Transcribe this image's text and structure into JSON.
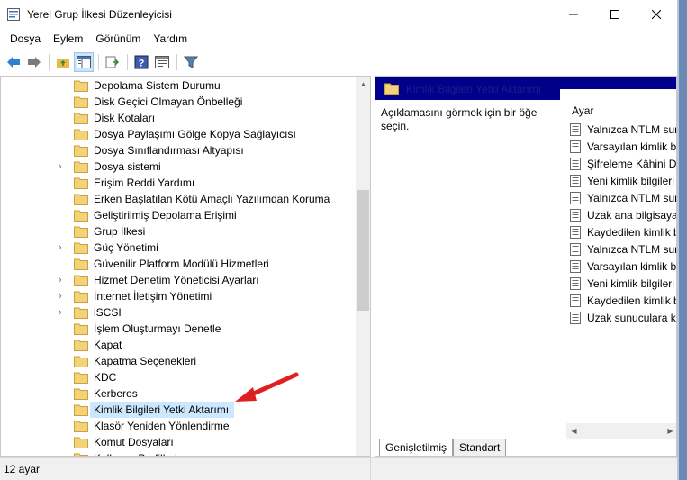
{
  "window": {
    "title": "Yerel Grup İlkesi Düzenleyicisi",
    "minimize": "—",
    "maximize": "☐",
    "close": "✕"
  },
  "menu": [
    "Dosya",
    "Eylem",
    "Görünüm",
    "Yardım"
  ],
  "toolbar": {
    "icons": [
      "back-arrow-icon",
      "forward-arrow-icon",
      "up-folder-icon",
      "show-tree-icon",
      "export-list-icon",
      "help-icon",
      "properties-icon",
      "filter-icon"
    ]
  },
  "tree": {
    "items": [
      {
        "label": "Depolama Sistem Durumu",
        "expandable": false
      },
      {
        "label": "Disk Geçici Olmayan Önbelleği",
        "expandable": false
      },
      {
        "label": "Disk Kotaları",
        "expandable": false
      },
      {
        "label": "Dosya Paylaşımı Gölge Kopya Sağlayıcısı",
        "expandable": false
      },
      {
        "label": "Dosya Sınıflandırması Altyapısı",
        "expandable": false
      },
      {
        "label": "Dosya sistemi",
        "expandable": true
      },
      {
        "label": "Erişim Reddi Yardımı",
        "expandable": false
      },
      {
        "label": "Erken Başlatılan Kötü Amaçlı Yazılımdan Koruma",
        "expandable": false
      },
      {
        "label": "Geliştirilmiş Depolama Erişimi",
        "expandable": false
      },
      {
        "label": "Grup İlkesi",
        "expandable": false
      },
      {
        "label": "Güç Yönetimi",
        "expandable": true
      },
      {
        "label": "Güvenilir Platform Modülü Hizmetleri",
        "expandable": false
      },
      {
        "label": "Hizmet Denetim Yöneticisi Ayarları",
        "expandable": true
      },
      {
        "label": "İnternet İletişim Yönetimi",
        "expandable": true
      },
      {
        "label": "iSCSI",
        "expandable": true
      },
      {
        "label": "İşlem Oluşturmayı Denetle",
        "expandable": false
      },
      {
        "label": "Kapat",
        "expandable": false
      },
      {
        "label": "Kapatma Seçenekleri",
        "expandable": false
      },
      {
        "label": "KDC",
        "expandable": false
      },
      {
        "label": "Kerberos",
        "expandable": false
      },
      {
        "label": "Kimlik Bilgileri Yetki Aktarımı",
        "expandable": false,
        "selected": true
      },
      {
        "label": "Klasör Yeniden Yönlendirme",
        "expandable": false
      },
      {
        "label": "Komut Dosyaları",
        "expandable": false
      },
      {
        "label": "Kullanıcı Profilleri",
        "expandable": false
      }
    ]
  },
  "details": {
    "header": "Kimlik Bilgileri Yetki Aktarımı",
    "description": "Açıklamasını görmek için bir öğe seçin.",
    "column_header": "Ayar",
    "settings": [
      "Yalnızca NTLM sun",
      "Varsayılan kimlik bi",
      "Şifreleme Kâhini Dü",
      "Yeni kimlik bilgileri",
      "Yalnızca NTLM sun",
      "Uzak ana bilgisayar",
      "Kaydedilen kimlik b",
      "Yalnızca NTLM sun",
      "Varsayılan kimlik bi",
      "Yeni kimlik bilgileri",
      "Kaydedilen kimlik b",
      "Uzak sunuculara ki"
    ]
  },
  "view_tabs": [
    "Genişletilmiş",
    "Standart"
  ],
  "status": "12 ay​ar"
}
